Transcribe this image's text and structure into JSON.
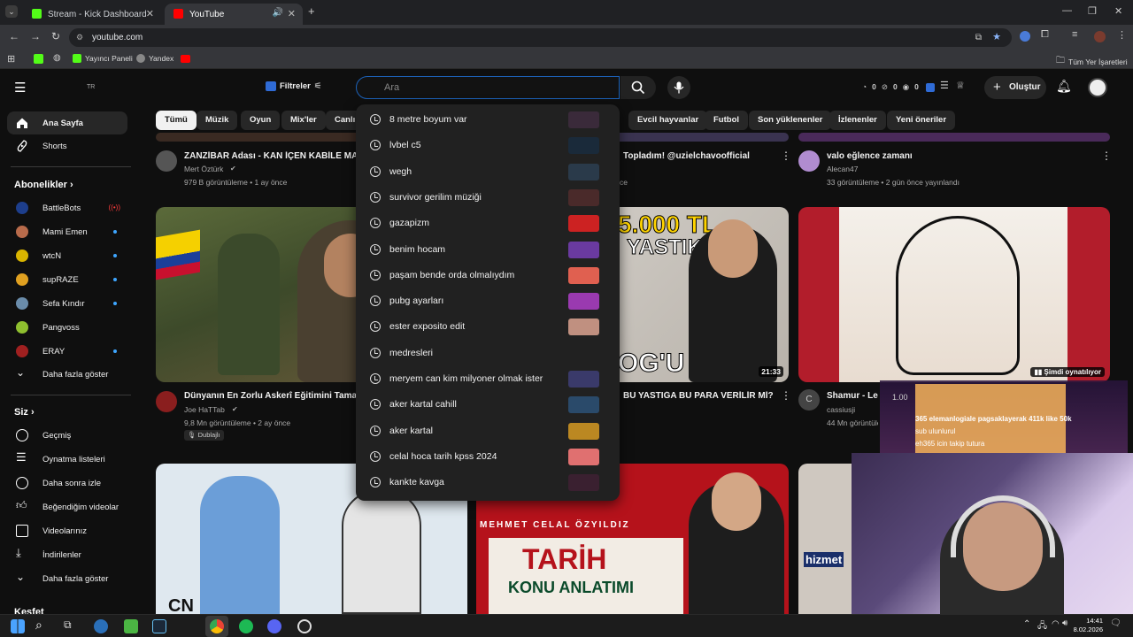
{
  "browser": {
    "tabs": [
      {
        "title": "Stream - Kick Dashboard",
        "favicon": "kick-icon"
      },
      {
        "title": "YouTube",
        "favicon": "youtube-icon"
      }
    ],
    "url": "youtube.com",
    "bookmarks": [
      {
        "label": "Yayıncı Paneli"
      },
      {
        "label": "Yandex"
      }
    ],
    "all_bookmarks": "Tüm Yer İşaretleri"
  },
  "header": {
    "country": "TR",
    "filters": "Filtreler",
    "search_placeholder": "Ara",
    "counters": [
      "0",
      "0",
      "0"
    ],
    "create": "Oluştur"
  },
  "chips": [
    "Tümü",
    "Müzik",
    "Oyun",
    "Mix'ler",
    "Canlı",
    "Evcil hayvanlar",
    "Futbol",
    "Son yüklenenler",
    "İzlenenler",
    "Yeni öneriler"
  ],
  "sidebar": {
    "main": [
      {
        "label": "Ana Sayfa",
        "icon": "home-icon"
      },
      {
        "label": "Shorts",
        "icon": "shorts-icon"
      }
    ],
    "subs_header": "Abonelikler",
    "subs": [
      {
        "label": "BattleBots",
        "live": true
      },
      {
        "label": "Mami Emen",
        "dot": true
      },
      {
        "label": "wtcN",
        "dot": true
      },
      {
        "label": "supRAZE",
        "dot": true
      },
      {
        "label": "Sefa Kındır",
        "dot": true
      },
      {
        "label": "Pangvoss",
        "dot": false
      },
      {
        "label": "ERAY",
        "dot": true
      }
    ],
    "subs_more": "Daha fazla göster",
    "you_header": "Siz",
    "you": [
      {
        "label": "Geçmiş",
        "icon": "history-icon"
      },
      {
        "label": "Oynatma listeleri",
        "icon": "playlist-icon"
      },
      {
        "label": "Daha sonra izle",
        "icon": "clock-icon"
      },
      {
        "label": "Beğendiğim videolar",
        "icon": "like-icon"
      },
      {
        "label": "Videolarınız",
        "icon": "video-icon"
      },
      {
        "label": "İndirilenler",
        "icon": "download-icon"
      }
    ],
    "you_more": "Daha fazla göster",
    "explore_header": "Keşfet"
  },
  "videos_row1": [
    {
      "title": "ZANZİBAR Adası - KAN İÇEN KABİLE MA",
      "channel": "Mert Öztürk",
      "meta": "979 B görüntüleme • 1 ay önce"
    },
    {
      "title": "Topladım! @uzielchavoofficial",
      "meta": "ce"
    },
    {
      "title": "valo eğlence zamanı",
      "channel": "Alecan47",
      "meta": "33 görüntüleme • 2 gün önce yayınlandı"
    }
  ],
  "videos_row2": [
    {
      "title": "Dünyanın En Zorlu Askerî Eğitimini Tama",
      "channel": "Joe HaTTab",
      "meta": "9,8 Mn görüntüleme • 2 ay önce",
      "badge": "Dublajlı"
    },
    {
      "title": "BU YASTIĞA BU PARA VERİLİR Mİ?",
      "duration": "21:33",
      "overlay_top": "5.000 TL",
      "overlay_mid": "YASTIK!",
      "overlay_bottom": "OG'U"
    },
    {
      "title": "Shamur - Le",
      "channel": "cassiusji",
      "meta": "44 Mn görüntülen",
      "now_playing": "Şimdi oynatılıyor",
      "avatar_letter": "C"
    }
  ],
  "videos_row3": [
    {
      "overlay": "CN"
    },
    {
      "overlay_top": "MEHMET CELAL ÖZYILDIZ",
      "overlay_title": "TARİH",
      "overlay_sub": "KONU ANLATIMI"
    },
    {
      "overlay": "hizmet"
    }
  ],
  "suggestions": [
    "8 metre boyum var",
    "lvbel c5",
    "wegh",
    "survivor gerilim müziği",
    "gazapizm",
    "benim hocam",
    "paşam bende orda olmalıydım",
    "pubg ayarları",
    "ester exposito edit",
    "medresleri",
    "meryem can kim milyoner olmak ister",
    "aker kartal cahill",
    "aker kartal",
    "celal hoca tarih kpss 2024",
    "kankte kavga"
  ],
  "stream_overlay": {
    "amount": "1.00",
    "line1": "365 elemanlogiale pagsaklayerak 411k like 50k",
    "line2": "sub ulunlurul",
    "line3": "eh365 icin takip tutura"
  },
  "taskbar": {
    "time": "14:41",
    "date": "8.02.2026"
  },
  "colors": {
    "accent": "#3ea6ff",
    "youtube_red": "#ff0000",
    "kick_green": "#53fc18"
  }
}
